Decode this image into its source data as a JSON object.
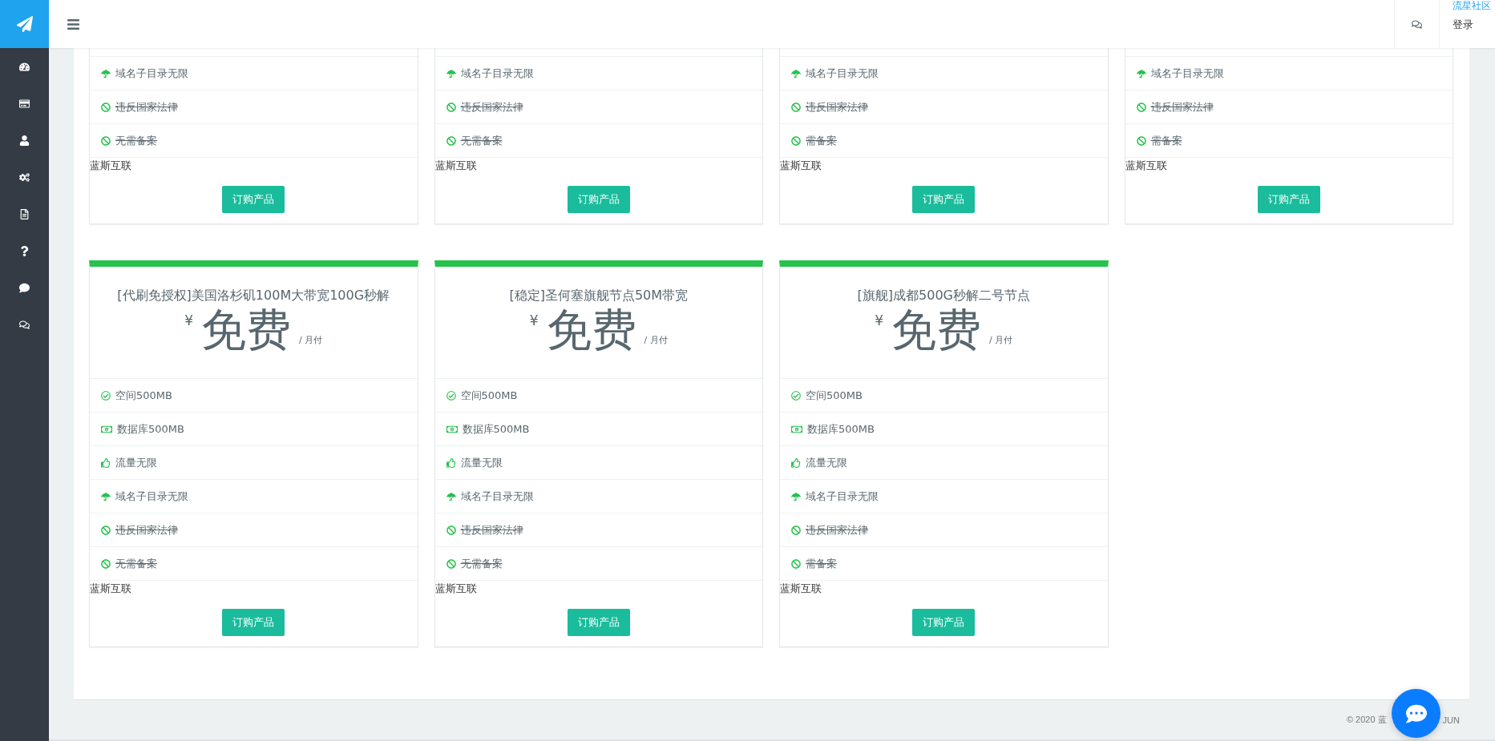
{
  "header": {
    "community_link": "流星社区",
    "login": "登录"
  },
  "partial_plans": [
    {
      "features": [
        {
          "kind": "domain",
          "text": "域名子目录无限",
          "struck": false
        },
        {
          "kind": "ban",
          "text": "违反国家法律",
          "struck": true
        },
        {
          "kind": "ban",
          "text": "无需备案",
          "struck": true
        }
      ],
      "vendor": "蓝斯互联",
      "button": "订购产品"
    },
    {
      "features": [
        {
          "kind": "domain",
          "text": "域名子目录无限",
          "struck": false
        },
        {
          "kind": "ban",
          "text": "违反国家法律",
          "struck": true
        },
        {
          "kind": "ban",
          "text": "无需备案",
          "struck": true
        }
      ],
      "vendor": "蓝斯互联",
      "button": "订购产品"
    },
    {
      "features": [
        {
          "kind": "domain",
          "text": "域名子目录无限",
          "struck": false
        },
        {
          "kind": "ban",
          "text": "违反国家法律",
          "struck": true
        },
        {
          "kind": "ban",
          "text": "需备案",
          "struck": true
        }
      ],
      "vendor": "蓝斯互联",
      "button": "订购产品"
    },
    {
      "features": [
        {
          "kind": "domain",
          "text": "域名子目录无限",
          "struck": false
        },
        {
          "kind": "ban",
          "text": "违反国家法律",
          "struck": true
        },
        {
          "kind": "ban",
          "text": "需备案",
          "struck": true
        }
      ],
      "vendor": "蓝斯互联",
      "button": "订购产品"
    }
  ],
  "plans": [
    {
      "title": "[代刷免授权]美国洛杉矶100M大带宽100G秒解",
      "currency": "¥",
      "price": "免费",
      "period": "/ 月付",
      "features": [
        {
          "kind": "space",
          "text": "空间500MB",
          "struck": false
        },
        {
          "kind": "database",
          "text": "数据库500MB",
          "struck": false
        },
        {
          "kind": "traffic",
          "text": "流量无限",
          "struck": false
        },
        {
          "kind": "domain",
          "text": "域名子目录无限",
          "struck": false
        },
        {
          "kind": "ban",
          "text": "违反国家法律",
          "struck": true
        },
        {
          "kind": "ban",
          "text": "无需备案",
          "struck": true
        }
      ],
      "vendor": "蓝斯互联",
      "button": "订购产品"
    },
    {
      "title": "[稳定]圣何塞旗舰节点50M带宽",
      "currency": "¥",
      "price": "免费",
      "period": "/ 月付",
      "features": [
        {
          "kind": "space",
          "text": "空间500MB",
          "struck": false
        },
        {
          "kind": "database",
          "text": "数据库500MB",
          "struck": false
        },
        {
          "kind": "traffic",
          "text": "流量无限",
          "struck": false
        },
        {
          "kind": "domain",
          "text": "域名子目录无限",
          "struck": false
        },
        {
          "kind": "ban",
          "text": "违反国家法律",
          "struck": true
        },
        {
          "kind": "ban",
          "text": "无需备案",
          "struck": true
        }
      ],
      "vendor": "蓝斯互联",
      "button": "订购产品"
    },
    {
      "title": "[旗舰]成都500G秒解二号节点",
      "currency": "¥",
      "price": "免费",
      "period": "/ 月付",
      "features": [
        {
          "kind": "space",
          "text": "空间500MB",
          "struck": false
        },
        {
          "kind": "database",
          "text": "数据库500MB",
          "struck": false
        },
        {
          "kind": "traffic",
          "text": "流量无限",
          "struck": false
        },
        {
          "kind": "domain",
          "text": "域名子目录无限",
          "struck": false
        },
        {
          "kind": "ban",
          "text": "违反国家法律",
          "struck": true
        },
        {
          "kind": "ban",
          "text": "需备案",
          "struck": true
        }
      ],
      "vendor": "蓝斯互联",
      "button": "订购产品"
    }
  ],
  "footer": {
    "copyright_start": "© 2020 蓝",
    "copyright_end": "JUN"
  }
}
